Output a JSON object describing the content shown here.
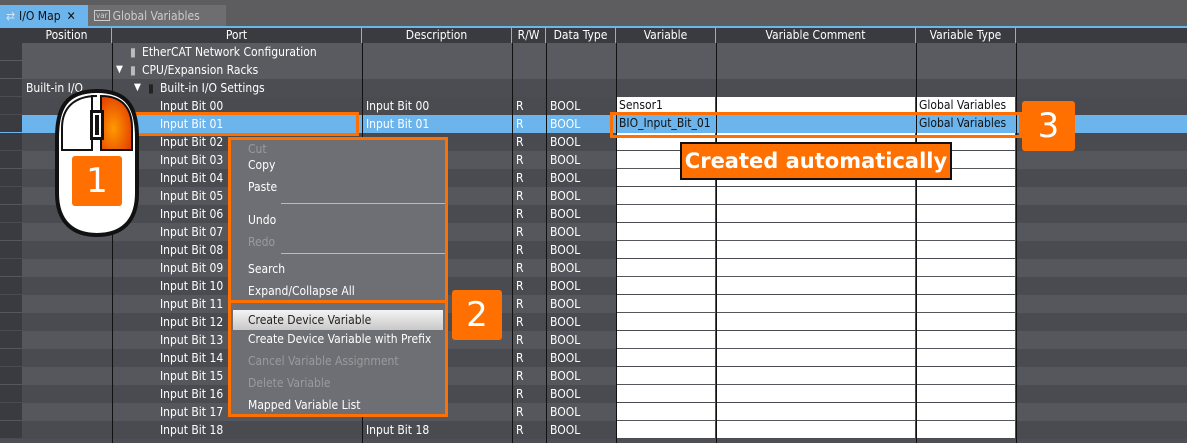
{
  "tabs": [
    {
      "label": "I/O Map",
      "icon": "io-map-icon",
      "active": true
    },
    {
      "label": "Global Variables",
      "icon": "var-icon",
      "icon_text": "var"
    }
  ],
  "columns": [
    "Position",
    "Port",
    "Description",
    "R/W",
    "Data Type",
    "Variable",
    "Variable Comment",
    "Variable Type"
  ],
  "tree": [
    {
      "label": "EtherCAT Network Configuration",
      "icon": "network-icon"
    },
    {
      "label": "CPU/Expansion Racks",
      "icon": "rack-icon"
    },
    {
      "position": "Built-in I/O",
      "label": "Built-in I/O Settings",
      "icon": "io-module-icon"
    }
  ],
  "rows": [
    {
      "port": "Input Bit 00",
      "description": "Input Bit 00",
      "rw": "R",
      "type": "BOOL",
      "variable": "Sensor1",
      "comment": "",
      "vartype": "Global Variables"
    },
    {
      "port": "Input Bit 01",
      "description": "Input Bit 01",
      "rw": "R",
      "type": "BOOL",
      "variable": "BIO_Input_Bit_01",
      "comment": "",
      "vartype": "Global Variables",
      "selected": true
    },
    {
      "port": "Input Bit 02",
      "rw": "R",
      "type": "BOOL"
    },
    {
      "port": "Input Bit 03",
      "rw": "R",
      "type": "BOOL"
    },
    {
      "port": "Input Bit 04",
      "rw": "R",
      "type": "BOOL"
    },
    {
      "port": "Input Bit 05",
      "rw": "R",
      "type": "BOOL"
    },
    {
      "port": "Input Bit 06",
      "rw": "R",
      "type": "BOOL"
    },
    {
      "port": "Input Bit 07",
      "rw": "R",
      "type": "BOOL"
    },
    {
      "port": "Input Bit 08",
      "rw": "R",
      "type": "BOOL"
    },
    {
      "port": "Input Bit 09",
      "rw": "R",
      "type": "BOOL"
    },
    {
      "port": "Input Bit 10",
      "rw": "R",
      "type": "BOOL"
    },
    {
      "port": "Input Bit 11",
      "rw": "R",
      "type": "BOOL"
    },
    {
      "port": "Input Bit 12",
      "rw": "R",
      "type": "BOOL"
    },
    {
      "port": "Input Bit 13",
      "rw": "R",
      "type": "BOOL"
    },
    {
      "port": "Input Bit 14",
      "rw": "R",
      "type": "BOOL"
    },
    {
      "port": "Input Bit 15",
      "rw": "R",
      "type": "BOOL"
    },
    {
      "port": "Input Bit 16",
      "rw": "R",
      "type": "BOOL"
    },
    {
      "port": "Input Bit 17",
      "rw": "R",
      "type": "BOOL"
    },
    {
      "port": "Input Bit 18",
      "description": "Input Bit 18",
      "rw": "R",
      "type": "BOOL"
    }
  ],
  "context_menu": [
    {
      "label": "Cut",
      "disabled": true
    },
    {
      "label": "Copy"
    },
    {
      "label": "Paste"
    },
    {
      "label": "Undo"
    },
    {
      "label": "Redo",
      "disabled": true
    },
    {
      "label": "Search"
    },
    {
      "label": "Expand/Collapse All"
    },
    {
      "label": "Create Device Variable",
      "highlighted": true
    },
    {
      "label": "Create Device Variable with Prefix"
    },
    {
      "label": "Cancel Variable Assignment",
      "disabled": true
    },
    {
      "label": "Delete Variable",
      "disabled": true
    },
    {
      "label": "Mapped Variable List"
    }
  ],
  "annotations": {
    "step1": "1",
    "step2": "2",
    "step3": "3",
    "callout": "Created automatically"
  },
  "colors": {
    "accent": "#ff7000",
    "selection": "#6cb4ec"
  }
}
